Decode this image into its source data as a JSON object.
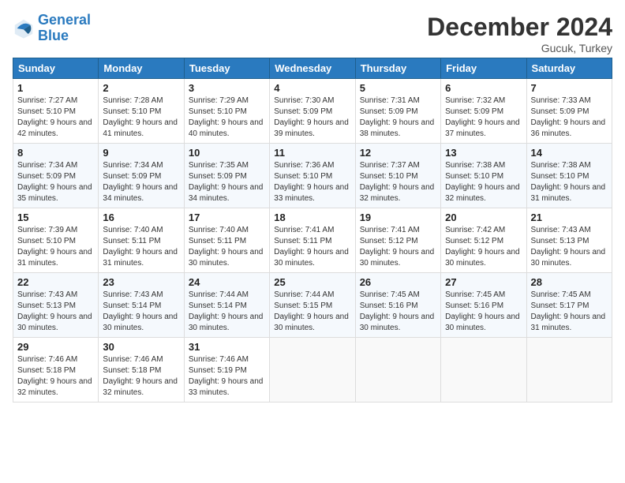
{
  "header": {
    "logo_line1": "General",
    "logo_line2": "Blue",
    "month": "December 2024",
    "location": "Gucuk, Turkey"
  },
  "days_of_week": [
    "Sunday",
    "Monday",
    "Tuesday",
    "Wednesday",
    "Thursday",
    "Friday",
    "Saturday"
  ],
  "weeks": [
    [
      {
        "day": "1",
        "sunrise": "7:27 AM",
        "sunset": "5:10 PM",
        "daylight": "9 hours and 42 minutes."
      },
      {
        "day": "2",
        "sunrise": "7:28 AM",
        "sunset": "5:10 PM",
        "daylight": "9 hours and 41 minutes."
      },
      {
        "day": "3",
        "sunrise": "7:29 AM",
        "sunset": "5:10 PM",
        "daylight": "9 hours and 40 minutes."
      },
      {
        "day": "4",
        "sunrise": "7:30 AM",
        "sunset": "5:09 PM",
        "daylight": "9 hours and 39 minutes."
      },
      {
        "day": "5",
        "sunrise": "7:31 AM",
        "sunset": "5:09 PM",
        "daylight": "9 hours and 38 minutes."
      },
      {
        "day": "6",
        "sunrise": "7:32 AM",
        "sunset": "5:09 PM",
        "daylight": "9 hours and 37 minutes."
      },
      {
        "day": "7",
        "sunrise": "7:33 AM",
        "sunset": "5:09 PM",
        "daylight": "9 hours and 36 minutes."
      }
    ],
    [
      {
        "day": "8",
        "sunrise": "7:34 AM",
        "sunset": "5:09 PM",
        "daylight": "9 hours and 35 minutes."
      },
      {
        "day": "9",
        "sunrise": "7:34 AM",
        "sunset": "5:09 PM",
        "daylight": "9 hours and 34 minutes."
      },
      {
        "day": "10",
        "sunrise": "7:35 AM",
        "sunset": "5:09 PM",
        "daylight": "9 hours and 34 minutes."
      },
      {
        "day": "11",
        "sunrise": "7:36 AM",
        "sunset": "5:10 PM",
        "daylight": "9 hours and 33 minutes."
      },
      {
        "day": "12",
        "sunrise": "7:37 AM",
        "sunset": "5:10 PM",
        "daylight": "9 hours and 32 minutes."
      },
      {
        "day": "13",
        "sunrise": "7:38 AM",
        "sunset": "5:10 PM",
        "daylight": "9 hours and 32 minutes."
      },
      {
        "day": "14",
        "sunrise": "7:38 AM",
        "sunset": "5:10 PM",
        "daylight": "9 hours and 31 minutes."
      }
    ],
    [
      {
        "day": "15",
        "sunrise": "7:39 AM",
        "sunset": "5:10 PM",
        "daylight": "9 hours and 31 minutes."
      },
      {
        "day": "16",
        "sunrise": "7:40 AM",
        "sunset": "5:11 PM",
        "daylight": "9 hours and 31 minutes."
      },
      {
        "day": "17",
        "sunrise": "7:40 AM",
        "sunset": "5:11 PM",
        "daylight": "9 hours and 30 minutes."
      },
      {
        "day": "18",
        "sunrise": "7:41 AM",
        "sunset": "5:11 PM",
        "daylight": "9 hours and 30 minutes."
      },
      {
        "day": "19",
        "sunrise": "7:41 AM",
        "sunset": "5:12 PM",
        "daylight": "9 hours and 30 minutes."
      },
      {
        "day": "20",
        "sunrise": "7:42 AM",
        "sunset": "5:12 PM",
        "daylight": "9 hours and 30 minutes."
      },
      {
        "day": "21",
        "sunrise": "7:43 AM",
        "sunset": "5:13 PM",
        "daylight": "9 hours and 30 minutes."
      }
    ],
    [
      {
        "day": "22",
        "sunrise": "7:43 AM",
        "sunset": "5:13 PM",
        "daylight": "9 hours and 30 minutes."
      },
      {
        "day": "23",
        "sunrise": "7:43 AM",
        "sunset": "5:14 PM",
        "daylight": "9 hours and 30 minutes."
      },
      {
        "day": "24",
        "sunrise": "7:44 AM",
        "sunset": "5:14 PM",
        "daylight": "9 hours and 30 minutes."
      },
      {
        "day": "25",
        "sunrise": "7:44 AM",
        "sunset": "5:15 PM",
        "daylight": "9 hours and 30 minutes."
      },
      {
        "day": "26",
        "sunrise": "7:45 AM",
        "sunset": "5:16 PM",
        "daylight": "9 hours and 30 minutes."
      },
      {
        "day": "27",
        "sunrise": "7:45 AM",
        "sunset": "5:16 PM",
        "daylight": "9 hours and 30 minutes."
      },
      {
        "day": "28",
        "sunrise": "7:45 AM",
        "sunset": "5:17 PM",
        "daylight": "9 hours and 31 minutes."
      }
    ],
    [
      {
        "day": "29",
        "sunrise": "7:46 AM",
        "sunset": "5:18 PM",
        "daylight": "9 hours and 32 minutes."
      },
      {
        "day": "30",
        "sunrise": "7:46 AM",
        "sunset": "5:18 PM",
        "daylight": "9 hours and 32 minutes."
      },
      {
        "day": "31",
        "sunrise": "7:46 AM",
        "sunset": "5:19 PM",
        "daylight": "9 hours and 33 minutes."
      },
      null,
      null,
      null,
      null
    ]
  ]
}
